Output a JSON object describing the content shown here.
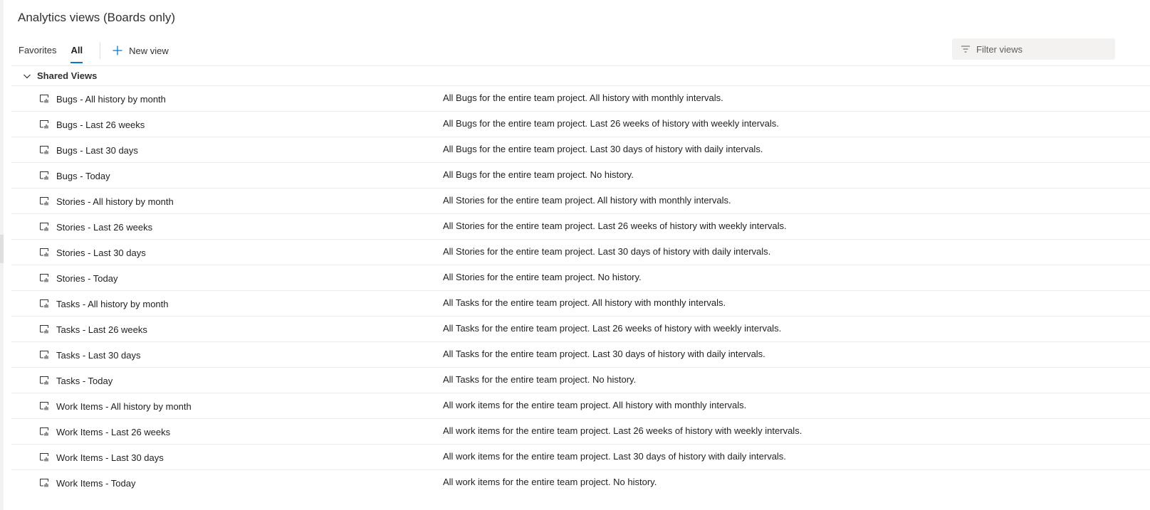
{
  "page": {
    "title": "Analytics views (Boards only)"
  },
  "pivots": {
    "favorites": "Favorites",
    "all": "All",
    "selected": "All"
  },
  "toolbar": {
    "new_view_label": "New view"
  },
  "filter": {
    "placeholder": "Filter views",
    "value": ""
  },
  "group": {
    "label": "Shared Views",
    "expanded": true
  },
  "views": [
    {
      "name": "Bugs - All history by month",
      "description": "All Bugs for the entire team project. All history with monthly intervals."
    },
    {
      "name": "Bugs - Last 26 weeks",
      "description": "All Bugs for the entire team project. Last 26 weeks of history with weekly intervals."
    },
    {
      "name": "Bugs - Last 30 days",
      "description": "All Bugs for the entire team project. Last 30 days of history with daily intervals."
    },
    {
      "name": "Bugs - Today",
      "description": "All Bugs for the entire team project. No history."
    },
    {
      "name": "Stories - All history by month",
      "description": "All Stories for the entire team project. All history with monthly intervals."
    },
    {
      "name": "Stories - Last 26 weeks",
      "description": "All Stories for the entire team project. Last 26 weeks of history with weekly intervals."
    },
    {
      "name": "Stories - Last 30 days",
      "description": "All Stories for the entire team project. Last 30 days of history with daily intervals."
    },
    {
      "name": "Stories - Today",
      "description": "All Stories for the entire team project. No history."
    },
    {
      "name": "Tasks - All history by month",
      "description": "All Tasks for the entire team project. All history with monthly intervals."
    },
    {
      "name": "Tasks - Last 26 weeks",
      "description": "All Tasks for the entire team project. Last 26 weeks of history with weekly intervals."
    },
    {
      "name": "Tasks - Last 30 days",
      "description": "All Tasks for the entire team project. Last 30 days of history with daily intervals."
    },
    {
      "name": "Tasks - Today",
      "description": "All Tasks for the entire team project. No history."
    },
    {
      "name": "Work Items - All history by month",
      "description": "All work items for the entire team project. All history with monthly intervals."
    },
    {
      "name": "Work Items - Last 26 weeks",
      "description": "All work items for the entire team project. Last 26 weeks of history with weekly intervals."
    },
    {
      "name": "Work Items - Last 30 days",
      "description": "All work items for the entire team project. Last 30 days of history with daily intervals."
    },
    {
      "name": "Work Items - Today",
      "description": "All work items for the entire team project. No history."
    }
  ],
  "icons": {
    "row_icon": "analytics-view-icon",
    "add": "plus-icon",
    "filter": "filter-icon",
    "group_toggle": "chevron-down-icon"
  },
  "colors": {
    "accent": "#0078d4",
    "text": "#201f1e",
    "divider": "#edebe9",
    "filter_background": "#f3f2f1"
  }
}
